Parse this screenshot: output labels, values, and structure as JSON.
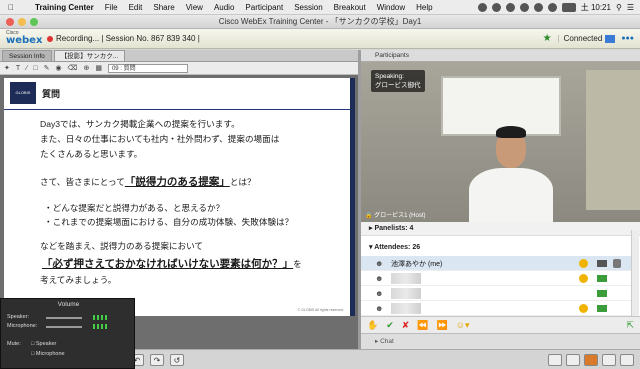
{
  "menubar": {
    "apple": "",
    "app_name": "Training Center",
    "menus": [
      "File",
      "Edit",
      "Share",
      "View",
      "Audio",
      "Participant",
      "Session",
      "Breakout",
      "Window",
      "Help"
    ],
    "clock": "土 10:21"
  },
  "window": {
    "title": "Cisco WebEx Training Center - 「サンカクの学校」Day1"
  },
  "statusbar": {
    "logo_top": "Cisco",
    "logo_main": "webex",
    "recording": "Recording... | Session No. 867 839 340 |",
    "connected": "Connected"
  },
  "left": {
    "tabs": [
      "Session Info",
      "【投影】サンカク..."
    ],
    "slide_selector": "09 : 質問",
    "slide": {
      "title": "質問",
      "lines": [
        "Day3では、サンカク掲載企業への提案を行います。",
        "また、日々の仕事においても社内・社外問わず、提案の場面は",
        "たくさんあると思います。",
        "さて、皆さまにとって",
        "「説得力のある提案」",
        "とは？",
        "・どんな提案だと説得力がある、と思えるか？",
        "・これまでの提案場面における、自分の成功体験、失敗体験は？",
        "などを踏まえ、説得力のある提案において",
        "「必ず押さえておかなければいけない要素は何か？」",
        "を",
        "考えてみましょう。"
      ],
      "footer": "© GLOBIS All rights reserved."
    }
  },
  "volume": {
    "title": "Volume",
    "speaker": "Speaker:",
    "microphone": "Microphone:",
    "mute": "Mute:",
    "mute_speaker": "Speaker",
    "mute_microphone": "Microphone"
  },
  "participants": {
    "header": "Participants",
    "speaking_label": "Speaking:",
    "speaking_name": "グロービス御代",
    "video_label": "グロービス1 (Host)",
    "panelists": "Panelists: 4",
    "attendees": "Attendees: 26",
    "rows": [
      {
        "name": "池澤あやか (me)"
      }
    ]
  },
  "chat": {
    "label": "Chat"
  }
}
